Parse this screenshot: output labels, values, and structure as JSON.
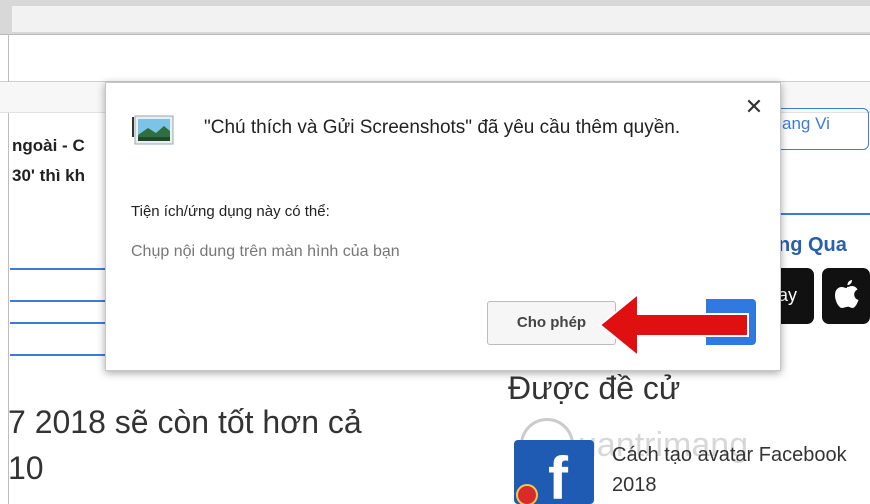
{
  "dialog": {
    "title": "\"Chú thích và Gửi Screenshots\" đã yêu cầu thêm quyền.",
    "close_symbol": "✕",
    "permissions_heading": "Tiện ích/ứng dụng này có thể:",
    "permissions": [
      "Chụp nội dung trên màn hình của bạn"
    ],
    "allow_label": "Cho phép",
    "icon": "screenshot-extension-icon"
  },
  "background": {
    "left_lines": [
      "ngoài - C",
      "30' thì kh"
    ],
    "headline_lines": [
      "7 2018 sẽ còn tốt hơn cả",
      "10"
    ],
    "language_label": "ang Vi",
    "right_heading": "ng Qua",
    "store_play_label": "ay",
    "recommended_title": "Được đề cử",
    "recommended_item": "Cách tạo avatar Facebook 2018",
    "watermark_text": "uantrimang"
  },
  "colors": {
    "accent_blue": "#3d7cd6",
    "arrow_red": "#e01010"
  }
}
